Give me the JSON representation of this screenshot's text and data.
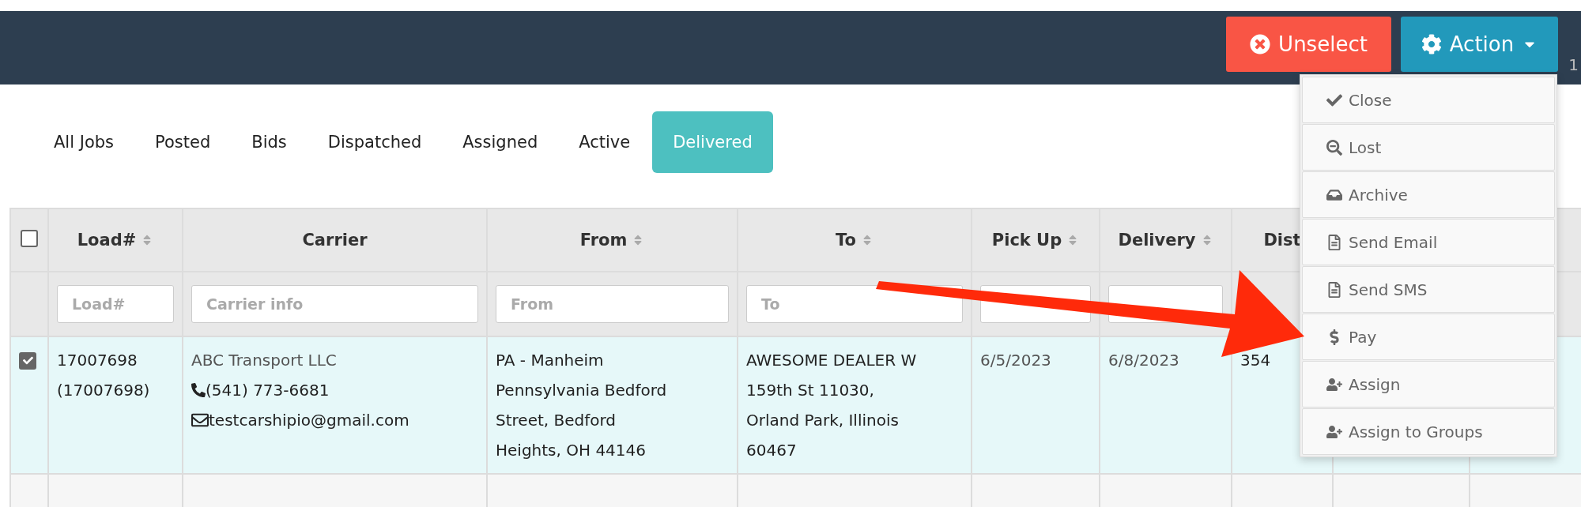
{
  "top_bar": {
    "buttons": [
      {
        "kind": "unselect",
        "label": "Unselect"
      },
      {
        "kind": "action",
        "label": "Action"
      }
    ],
    "counter": "1"
  },
  "tabs": [
    {
      "label": "All Jobs",
      "selected": false
    },
    {
      "label": "Posted",
      "selected": false
    },
    {
      "label": "Bids",
      "selected": false
    },
    {
      "label": "Dispatched",
      "selected": false
    },
    {
      "label": "Assigned",
      "selected": false
    },
    {
      "label": "Active",
      "selected": false
    },
    {
      "label": "Delivered",
      "selected": true
    }
  ],
  "table": {
    "select_all": {
      "checked": false
    },
    "columns": [
      {
        "label": "Load#",
        "sortable": true,
        "filter": true,
        "placeholder": "Load#"
      },
      {
        "label": "Carrier",
        "sortable": false,
        "filter": true,
        "placeholder": "Carrier info"
      },
      {
        "label": "From",
        "sortable": true,
        "filter": true,
        "placeholder": "From"
      },
      {
        "label": "To",
        "sortable": true,
        "filter": true,
        "placeholder": "To"
      },
      {
        "label": "Pick Up",
        "sortable": true,
        "filter": true
      },
      {
        "label": "Delivery",
        "sortable": true,
        "filter": true
      },
      {
        "label": "Dist",
        "sortable": false
      }
    ],
    "rows": [
      {
        "selected": true,
        "load": [
          "17007698",
          "(17007698)"
        ],
        "carrier": {
          "name": "ABC Transport LLC",
          "phone": "(541) 773-6681",
          "email": "testcarshipio@gmail.com"
        },
        "from": [
          "PA - Manheim",
          "Pennsylvania Bedford",
          "Street, Bedford",
          "Heights, OH 44146"
        ],
        "to": [
          "AWESOME DEALER W",
          "159th St 11030,",
          "Orland Park, Illinois",
          "60467"
        ],
        "pickup": "6/5/2023",
        "delivery": "6/8/2023",
        "dist": "354"
      }
    ]
  },
  "action_menu": {
    "items": [
      {
        "label": "Close"
      },
      {
        "label": "Lost"
      },
      {
        "label": "Archive"
      },
      {
        "label": "Send Email"
      },
      {
        "label": "Send SMS"
      },
      {
        "label": "Pay"
      },
      {
        "label": "Assign"
      },
      {
        "label": "Assign to Groups"
      }
    ]
  }
}
